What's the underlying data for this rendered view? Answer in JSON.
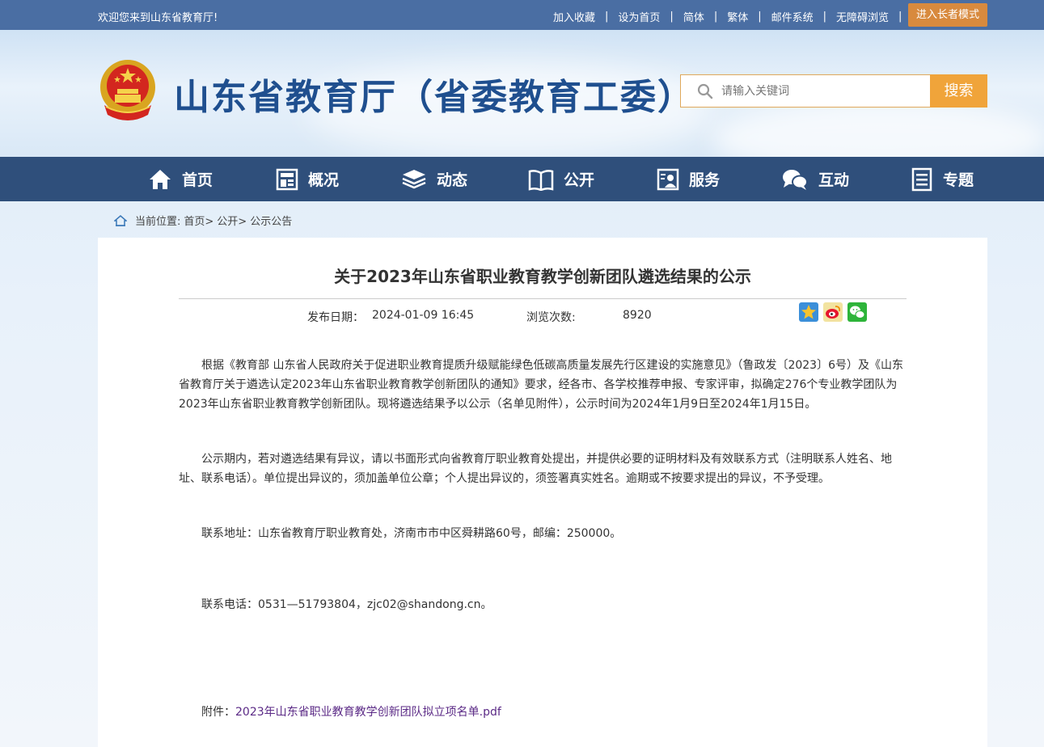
{
  "topbar": {
    "welcome": "欢迎您来到山东省教育厅!",
    "links": [
      "加入收藏",
      "设为首页",
      "简体",
      "繁体",
      "邮件系统",
      "无障碍浏览"
    ],
    "separator": "|",
    "elder_mode": "进入长者模式"
  },
  "header": {
    "title": "山东省教育厅（省委教育工委）",
    "search_placeholder": "请输入关键词",
    "search_button": "搜索"
  },
  "nav": {
    "items": [
      {
        "label": "首页",
        "icon": "home-icon"
      },
      {
        "label": "概况",
        "icon": "overview-icon"
      },
      {
        "label": "动态",
        "icon": "news-icon"
      },
      {
        "label": "公开",
        "icon": "book-icon"
      },
      {
        "label": "服务",
        "icon": "service-icon"
      },
      {
        "label": "互动",
        "icon": "chat-icon"
      },
      {
        "label": "专题",
        "icon": "topic-icon"
      }
    ]
  },
  "breadcrumb": {
    "prefix": "当前位置:",
    "items": [
      "首页>",
      "公开>",
      "公示公告"
    ]
  },
  "article": {
    "title": "关于2023年山东省职业教育教学创新团队遴选结果的公示",
    "date_label": "发布日期：",
    "date": "2024-01-09 16:45",
    "views_label": "浏览次数:",
    "views": "8920",
    "paragraphs": [
      "根据《教育部 山东省人民政府关于促进职业教育提质升级赋能绿色低碳高质量发展先行区建设的实施意见》（鲁政发〔2023〕6号）及《山东省教育厅关于遴选认定2023年山东省职业教育教学创新团队的通知》要求，经各市、各学校推荐申报、专家评审，拟确定276个专业教学团队为2023年山东省职业教育教学创新团队。现将遴选结果予以公示（名单见附件），公示时间为2024年1月9日至2024年1月15日。",
      "公示期内，若对遴选结果有异议，请以书面形式向省教育厅职业教育处提出，并提供必要的证明材料及有效联系方式（注明联系人姓名、地址、联系电话）。单位提出异议的，须加盖单位公章；个人提出异议的，须签署真实姓名。逾期或不按要求提出的异议，不予受理。",
      "联系地址：山东省教育厅职业教育处，济南市市中区舜耕路60号，邮编：250000。",
      "联系电话：0531—51793804，zjc02@shandong.cn。"
    ],
    "attachment_label": "附件：",
    "attachment_name": "2023年山东省职业教育教学创新团队拟立项名单.pdf"
  }
}
